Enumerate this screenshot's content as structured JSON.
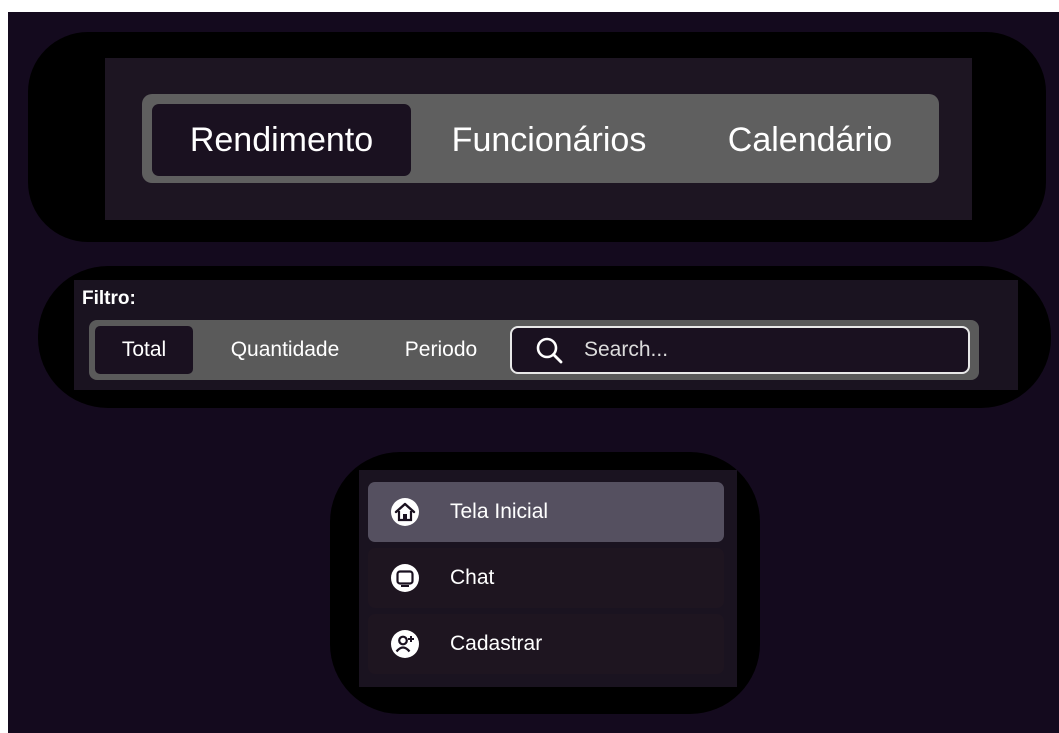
{
  "tabs": [
    {
      "label": "Rendimento",
      "active": true
    },
    {
      "label": "Funcionários",
      "active": false
    },
    {
      "label": "Calendário",
      "active": false
    }
  ],
  "filter": {
    "label": "Filtro:",
    "options": [
      {
        "label": "Total",
        "active": true
      },
      {
        "label": "Quantidade",
        "active": false
      },
      {
        "label": "Periodo",
        "active": false
      }
    ],
    "search": {
      "placeholder": "Search...",
      "value": "",
      "icon": "search-icon"
    }
  },
  "menu": {
    "items": [
      {
        "label": "Tela Inicial",
        "icon": "home-icon",
        "active": true
      },
      {
        "label": "Chat",
        "icon": "chat-icon",
        "active": false
      },
      {
        "label": "Cadastrar",
        "icon": "add-user-icon",
        "active": false
      }
    ]
  },
  "colors": {
    "background": "#140a1e",
    "halo": "#000000",
    "panel": "#1a1320",
    "tab_bar": "#5f5f5f",
    "active_item": "#1a1120",
    "active_menu_item": "#555060",
    "text": "#ffffff"
  }
}
